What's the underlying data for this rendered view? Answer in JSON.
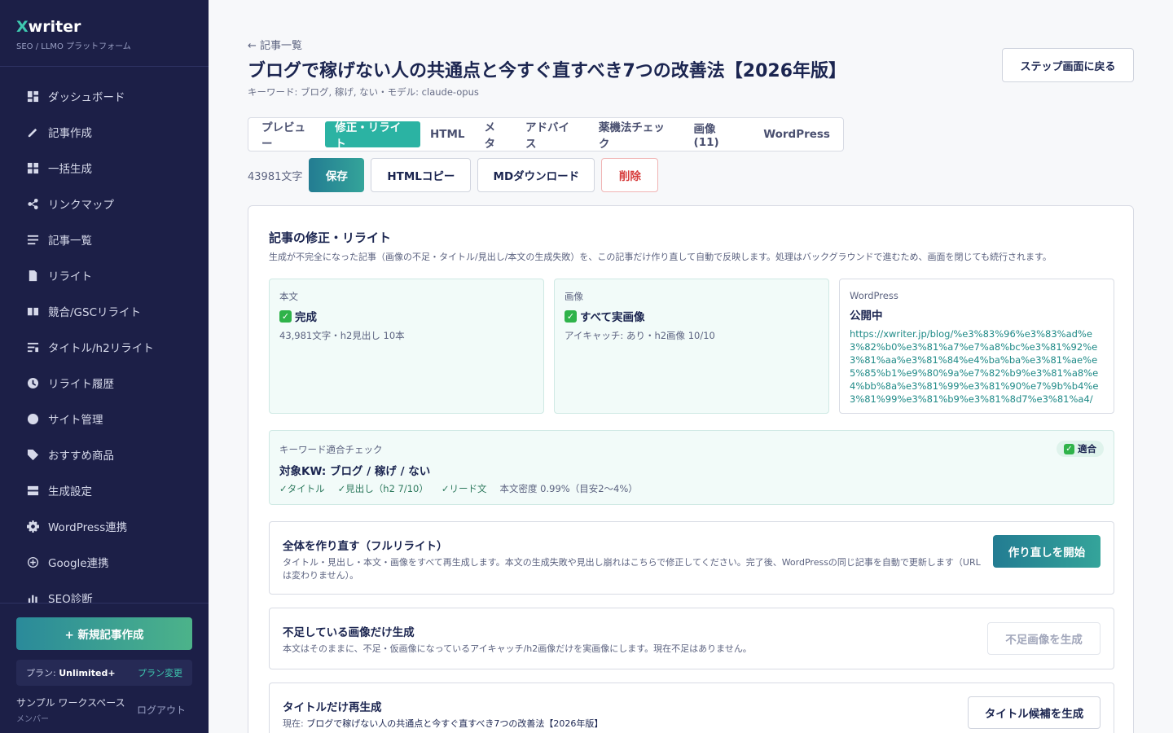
{
  "brand": {
    "x": "X",
    "rest": "writer",
    "sub": "SEO / LLMO プラットフォーム"
  },
  "nav": [
    {
      "label": "ダッシュボード",
      "icon": "dashboard-icon"
    },
    {
      "label": "記事作成",
      "icon": "pencil-icon"
    },
    {
      "label": "一括生成",
      "icon": "grid-icon"
    },
    {
      "label": "リンクマップ",
      "icon": "share-icon"
    },
    {
      "label": "記事一覧",
      "icon": "list-icon"
    },
    {
      "label": "リライト",
      "icon": "document-icon"
    },
    {
      "label": "競合/GSCリライト",
      "icon": "book-icon"
    },
    {
      "label": "タイトル/h2リライト",
      "icon": "heading-icon"
    },
    {
      "label": "リライト履歴",
      "icon": "clock-icon"
    },
    {
      "label": "サイト管理",
      "icon": "globe-icon"
    },
    {
      "label": "おすすめ商品",
      "icon": "tag-icon"
    },
    {
      "label": "生成設定",
      "icon": "drawer-icon"
    },
    {
      "label": "WordPress連携",
      "icon": "gear-icon"
    },
    {
      "label": "Google連携",
      "icon": "plus-circle-icon"
    },
    {
      "label": "SEO診断",
      "icon": "chart-icon"
    }
  ],
  "sidebar_bottom": {
    "new_article": "+ 新規記事作成",
    "plan_prefix": "プラン: ",
    "plan_name": "Unlimited+",
    "plan_change": "プラン変更",
    "workspace_name": "サンプル ワークスペース",
    "workspace_role": "メンバー",
    "logout": "ログアウト"
  },
  "header": {
    "back": "← 記事一覧",
    "title": "ブログで稼げない人の共通点と今すぐ直すべき7つの改善法【2026年版】",
    "meta": "キーワード: ブログ, 稼げ, ない・モデル: claude-opus",
    "step_back": "ステップ画面に戻る"
  },
  "tabs": [
    {
      "label": "プレビュー",
      "active": false
    },
    {
      "label": "修正・リライト",
      "active": true
    },
    {
      "label": "HTML",
      "active": false
    },
    {
      "label": "メタ",
      "active": false
    },
    {
      "label": "アドバイス",
      "active": false
    },
    {
      "label": "薬機法チェック",
      "active": false
    },
    {
      "label": "画像 (11)",
      "active": false
    },
    {
      "label": "WordPress",
      "active": false
    }
  ],
  "actions": {
    "char_count": "43981文字",
    "save": "保存",
    "html_copy": "HTMLコピー",
    "md_download": "MDダウンロード",
    "delete": "削除"
  },
  "panel": {
    "title": "記事の修正・リライト",
    "desc": "生成が不完全になった記事（画像の不足・タイトル/見出し/本文の生成失敗）を、この記事だけ作り直して自動で反映します。処理はバックグラウンドで進むため、画面を閉じても続行されます。",
    "cards": {
      "body": {
        "label": "本文",
        "value": "完成",
        "sub": "43,981文字・h2見出し 10本"
      },
      "image": {
        "label": "画像",
        "value": "すべて実画像",
        "sub": "アイキャッチ: あり・h2画像 10/10"
      },
      "wp": {
        "label": "WordPress",
        "value": "公開中",
        "url": "https://xwriter.jp/blog/%e3%83%96%e3%83%ad%e3%82%b0%e3%81%a7%e7%a8%bc%e3%81%92%e3%81%aa%e3%81%84%e4%ba%ba%e3%81%ae%e5%85%b1%e9%80%9a%e7%82%b9%e3%81%a8%e4%bb%8a%e3%81%99%e3%81%90%e7%9b%b4%e3%81%99%e3%81%b9%e3%81%8d7%e3%81%a4/"
      }
    },
    "keyword": {
      "head": "キーワード適合チェック",
      "badge": "適合",
      "title": "対象KW: ブログ / 稼げ / ない",
      "checks": [
        "✓タイトル",
        "✓見出し（h2 7/10）",
        "✓リード文"
      ],
      "density": "本文密度 0.99%（目安2〜4%）"
    },
    "full_rewrite": {
      "title": "全体を作り直す（フルリライト）",
      "desc": "タイトル・見出し・本文・画像をすべて再生成します。本文の生成失敗や見出し崩れはこちらで修正してください。完了後、WordPressの同じ記事を自動で更新します（URLは変わりません）。",
      "button": "作り直しを開始"
    },
    "images_only": {
      "title": "不足している画像だけ生成",
      "desc": "本文はそのままに、不足・仮画像になっているアイキャッチ/h2画像だけを実画像にします。現在不足はありません。",
      "button": "不足画像を生成"
    },
    "title_only": {
      "title": "タイトルだけ再生成",
      "current_prefix": "現在: ",
      "current": "ブログで稼げない人の共通点と今すぐ直すべき7つの改善法【2026年版】",
      "button": "タイトル候補を生成"
    }
  }
}
